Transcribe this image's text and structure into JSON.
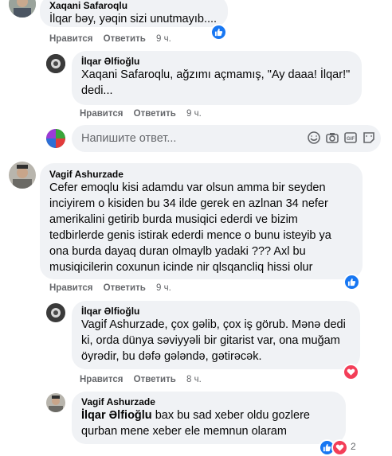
{
  "comments": [
    {
      "author": "Xaqani Safaroqlu",
      "text": "İlqar bəy, yəqin sizi unutmayıb....",
      "like_label": "Нравится",
      "reply_label": "Ответить",
      "time": "9 ч.",
      "reaction": "like-icon"
    },
    {
      "author": "İlqar Əlfioğlu",
      "line1": "Xaqani Safaroqlu, ağzımı açmamış, \"Ay daaa! İlqar!\"",
      "line2": "dedi...",
      "like_label": "Нравится",
      "reply_label": "Ответить",
      "time": "9 ч."
    },
    {
      "author": "Vagif Ashurzade",
      "line1": "Cefer emoqlu kisi adamdu var olsun amma bir seyden",
      "line2": "inciyirem o kisiden bu 34 ilde gerek en azlnan 34 nefer",
      "line3": "amerikalini getirib burda musiqici ederdi ve bizim",
      "line4": "tedbirlerde genis istirak ederdi mence o bunu isteyib ya",
      "line5": "ona burda dayaq duran olmaylb yadaki ??? Axl bu",
      "line6": "musiqicilerin coxunun icinde nir qlsqancliq hissi olur",
      "like_label": "Нравится",
      "reply_label": "Ответить",
      "time": "9 ч.",
      "reaction": "like-icon"
    },
    {
      "author": "İlqar Əlfioğlu",
      "line1": "Vagif Ashurzade, çox gəlib, çox iş görub. Mənə dedi",
      "line2": "ki, orda dünya səviyyəli bir gitarist var, ona muğam",
      "line3": "öyrədir, bu dəfə gələndə, gətirəcək.",
      "like_label": "Нравится",
      "reply_label": "Ответить",
      "time": "8 ч.",
      "reaction": "heart-icon"
    },
    {
      "author": "Vagif Ashurzade",
      "mention": "İlqar Əlfioğlu",
      "line1_rest": " bax bu sad xeber oldu gozlere",
      "line2": "qurban mene xeber ele memnun olaram",
      "reaction_count": "2"
    }
  ],
  "reply_box": {
    "placeholder": "Напишите ответ..."
  }
}
